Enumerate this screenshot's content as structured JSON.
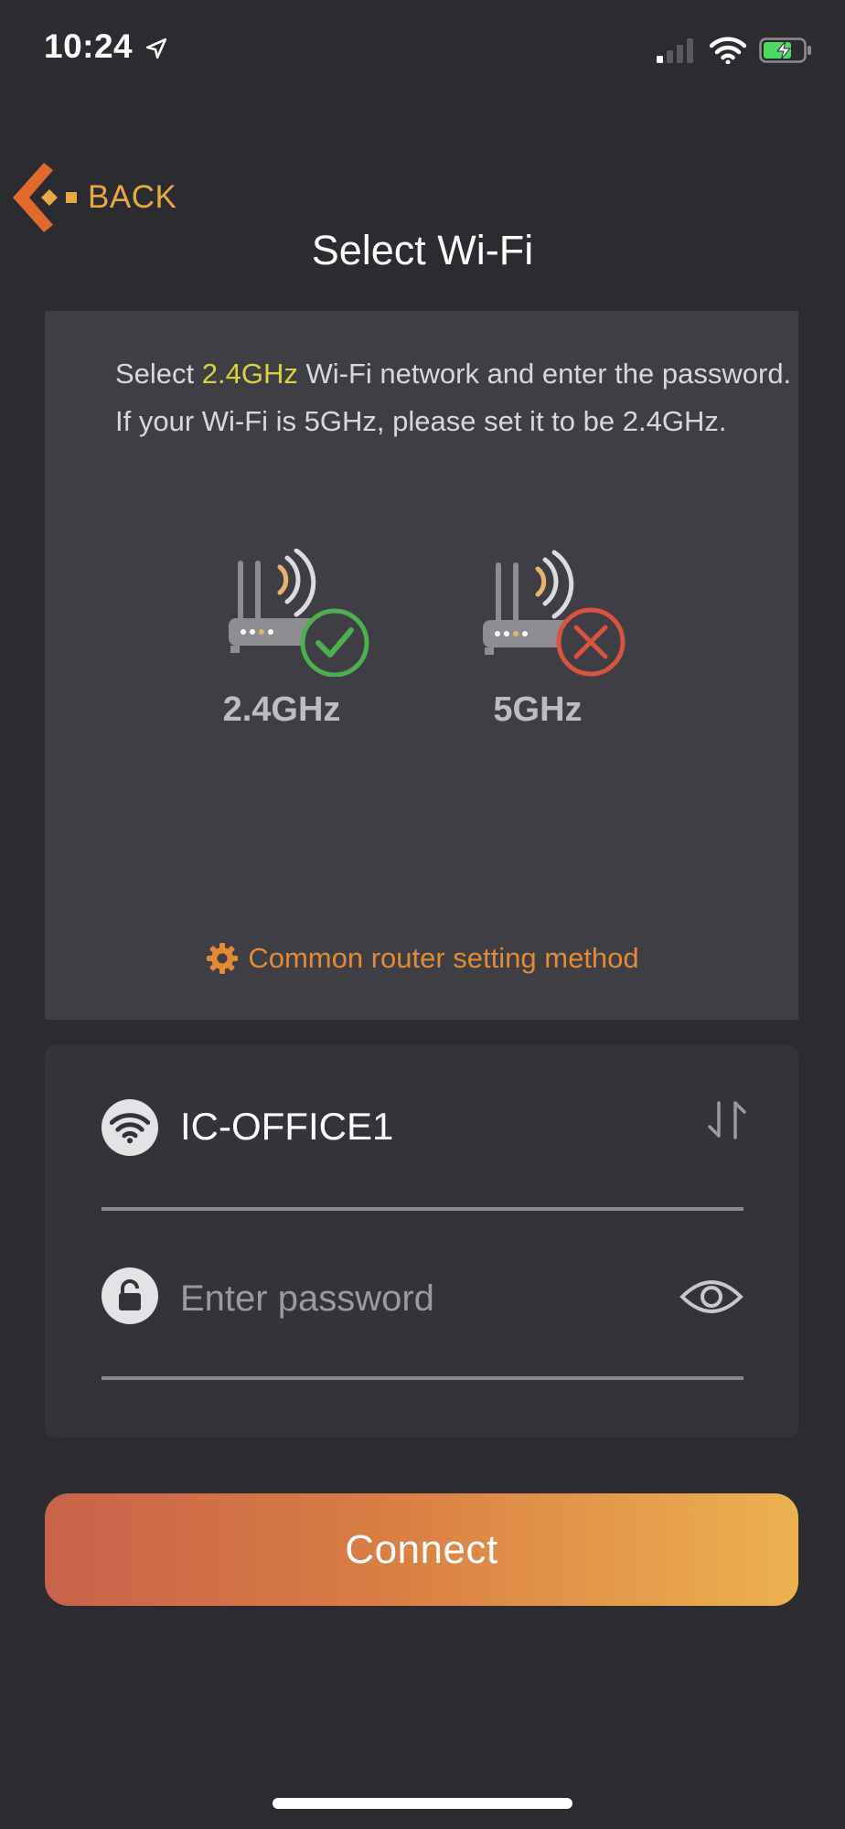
{
  "status_bar": {
    "time": "10:24"
  },
  "nav": {
    "back_label": "BACK",
    "title": "Select Wi-Fi"
  },
  "info": {
    "line1_prefix": "Select ",
    "line1_highlight": "2.4GHz",
    "line1_suffix": " Wi-Fi network and enter the password.",
    "line2": "If your Wi-Fi is 5GHz, please set it to be 2.4GHz.",
    "router_ok_label": "2.4GHz",
    "router_bad_label": "5GHz",
    "router_setting_label": "Common router setting method"
  },
  "form": {
    "ssid": "IC-OFFICE1",
    "password_value": "",
    "password_placeholder": "Enter password"
  },
  "actions": {
    "connect_label": "Connect"
  },
  "colors": {
    "background": "#2c2b30",
    "accent_orange": "#e8a844",
    "highlight_yellow": "#d9d23a",
    "ok_green": "#4caf50",
    "error_red": "#d9533e"
  }
}
